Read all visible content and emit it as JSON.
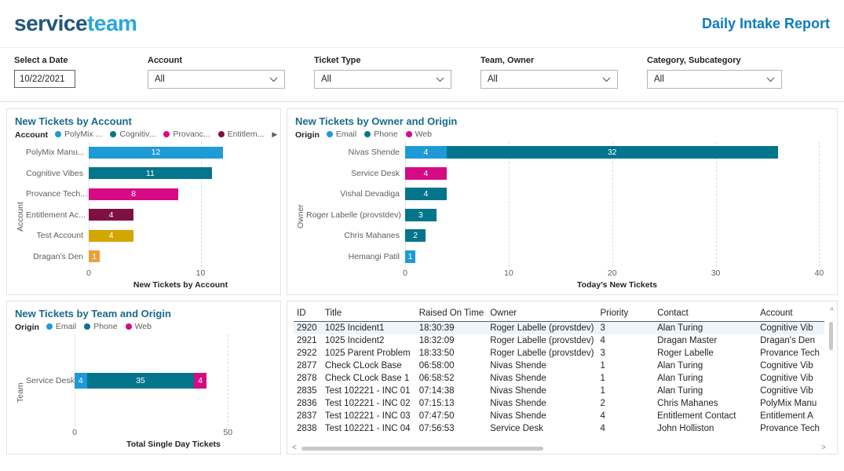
{
  "header": {
    "logo": {
      "part1": "service",
      "part2": "team"
    },
    "title": "Daily Intake Report"
  },
  "filters": [
    {
      "label": "Select a Date",
      "value": "10/22/2021"
    },
    {
      "label": "Account",
      "value": "All"
    },
    {
      "label": "Ticket Type",
      "value": "All"
    },
    {
      "label": "Team, Owner",
      "value": "All"
    },
    {
      "label": "Category, Subcategory",
      "value": "All"
    }
  ],
  "icons": {
    "scroll_up": "^",
    "scroll_left": "<",
    "scroll_right": ">",
    "dropdown_chevron": "chevron-down",
    "legend_overflow": "▶"
  },
  "colors": {
    "accent_blue": "#0D7CC1",
    "email": "#1E9AD6",
    "phone": "#04758C",
    "web": "#D60A85",
    "maroon": "#7E1044",
    "gold": "#D3A602",
    "orange": "#E9A13B",
    "panel_title": "#166B8A"
  },
  "chart_data": [
    {
      "type": "bar",
      "title": "New Tickets by Account",
      "legend_title": "Account",
      "legend": [
        {
          "label": "PolyMix ...",
          "color": "#1E9AD6"
        },
        {
          "label": "Cognitiv...",
          "color": "#04758C"
        },
        {
          "label": "Provanc...",
          "color": "#D60A85"
        },
        {
          "label": "Entitlem...",
          "color": "#7E1044"
        }
      ],
      "legend_overflow": "▶",
      "categories": [
        "PolyMix Manu...",
        "Cognitive Vibes",
        "Provance Tech...",
        "Entitlement Ac...",
        "Test Account",
        "Dragan's Den"
      ],
      "values": [
        12,
        11,
        8,
        4,
        4,
        1
      ],
      "colors": [
        "#1E9AD6",
        "#04758C",
        "#D60A85",
        "#7E1044",
        "#D3A602",
        "#E9A13B"
      ],
      "xlabel": "New Tickets by Account",
      "ylabel": "Account",
      "xticks": [
        0,
        10
      ],
      "axis_max": 16,
      "grid": true,
      "legend_position": "top"
    },
    {
      "type": "stacked-bar",
      "title": "New Tickets by Owner and Origin",
      "legend_title": "Origin",
      "legend": [
        {
          "label": "Email",
          "color": "#1E9AD6"
        },
        {
          "label": "Phone",
          "color": "#04758C"
        },
        {
          "label": "Web",
          "color": "#D60A85"
        }
      ],
      "categories": [
        "Nivas Shende",
        "Service Desk",
        "Vishal Devadiga",
        "Roger Labelle (provstdev)",
        "Chris Mahanes",
        "Hemangi Patil"
      ],
      "series": [
        {
          "name": "Email",
          "color": "#1E9AD6",
          "values": [
            4,
            0,
            0,
            0,
            0,
            1
          ]
        },
        {
          "name": "Phone",
          "color": "#04758C",
          "values": [
            32,
            0,
            4,
            3,
            2,
            0
          ]
        },
        {
          "name": "Web",
          "color": "#D60A85",
          "values": [
            0,
            4,
            0,
            0,
            0,
            0
          ]
        }
      ],
      "xlabel": "Today's New Tickets",
      "ylabel": "Owner",
      "xticks": [
        0,
        10,
        20,
        30,
        40
      ],
      "axis_max": 40.5,
      "grid": true,
      "legend_position": "top"
    },
    {
      "type": "stacked-bar",
      "title": "New Tickets by Team and Origin",
      "legend_title": "Origin",
      "legend": [
        {
          "label": "Email",
          "color": "#1E9AD6"
        },
        {
          "label": "Phone",
          "color": "#04758C"
        },
        {
          "label": "Web",
          "color": "#D60A85"
        }
      ],
      "categories": [
        "Service Desk"
      ],
      "series": [
        {
          "name": "Email",
          "color": "#1E9AD6",
          "values": [
            4
          ]
        },
        {
          "name": "Phone",
          "color": "#04758C",
          "values": [
            35
          ]
        },
        {
          "name": "Web",
          "color": "#D60A85",
          "values": [
            4
          ]
        }
      ],
      "xlabel": "Total Single Day Tickets",
      "ylabel": "Team",
      "xticks": [
        0,
        50
      ],
      "axis_max": 63,
      "grid": true,
      "legend_position": "top"
    },
    {
      "type": "table",
      "columns": [
        "ID",
        "Title",
        "Raised On Time",
        "Owner",
        "Priority",
        "Contact",
        "Account"
      ],
      "selected_row_index": 0,
      "rows": [
        [
          "2920",
          "1025 Incident1",
          "18:30:39",
          "Roger Labelle (provstdev)",
          "3",
          "Alan Turing",
          "Cognitive Vib"
        ],
        [
          "2921",
          "1025 Incident2",
          "18:32:09",
          "Roger Labelle (provstdev)",
          "4",
          "Dragan Master",
          "Dragan's Den"
        ],
        [
          "2922",
          "1025 Parent Problem",
          "18:33:50",
          "Roger Labelle (provstdev)",
          "3",
          "Roger Labelle",
          "Provance Tech"
        ],
        [
          "2877",
          "Check CLock Base",
          "06:58:00",
          "Nivas Shende",
          "1",
          "Alan Turing",
          "Cognitive Vib"
        ],
        [
          "2878",
          "Check CLock Base 1",
          "06:58:52",
          "Nivas Shende",
          "1",
          "Alan Turing",
          "Cognitive Vib"
        ],
        [
          "2835",
          "Test 102221 - INC 01",
          "07:14:38",
          "Nivas Shende",
          "1",
          "Alan Turing",
          "Cognitive Vib"
        ],
        [
          "2836",
          "Test 102221 - INC 02",
          "07:15:13",
          "Nivas Shende",
          "2",
          "Chris Mahanes",
          "PolyMix Manu"
        ],
        [
          "2837",
          "Test 102221 - INC 03",
          "07:47:50",
          "Nivas Shende",
          "4",
          "Entitlement Contact",
          "Entitlement A"
        ],
        [
          "2838",
          "Test 102221 - INC 04",
          "07:56:53",
          "Service Desk",
          "4",
          "John Holliston",
          "Provance Tech"
        ]
      ]
    }
  ]
}
